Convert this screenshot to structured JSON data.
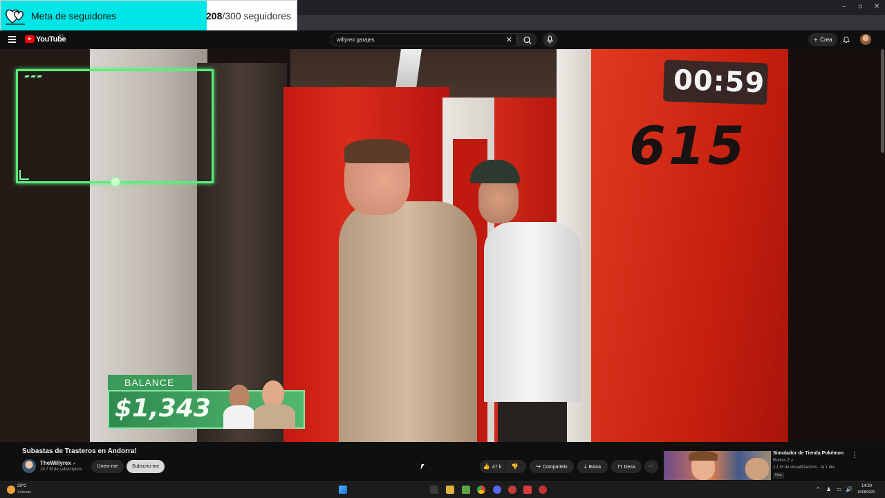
{
  "overlay": {
    "goal_label": "Meta de seguidores",
    "goal_current": "208",
    "goal_total": "/300 seguidores",
    "goal_progress_fraction": 0.693
  },
  "header": {
    "logo_text": "YouTube",
    "country_code": "ES",
    "search_value": "willyrex garajes",
    "create_label": "Crea"
  },
  "video": {
    "timer": "00:59",
    "unit_number": "615",
    "balance_label": "BALANCE",
    "balance_value": "$1,343"
  },
  "below_video": {
    "title": "Subastas de Trasteros en Andorra!",
    "channel_name": "TheWillyrex",
    "subscribers": "18,7 M de subscriptors",
    "join_label": "Uneix-me",
    "subscribe_label": "Subscriu-me",
    "like_count": "47 k",
    "share_label": "Comparteix",
    "download_label": "Baixa",
    "save_label": "Desa"
  },
  "recommendation": {
    "title": "Simulador de Tienda Pokémon",
    "channel": "Rubius Z",
    "meta": "2,1 M de visualitzacions · fa 1 dia",
    "badge": "Nou"
  },
  "taskbar": {
    "temperature": "29°C",
    "weather": "Soleado",
    "time": "14:30",
    "date": "10/08/2026"
  },
  "colors": {
    "goal_fill": "#00e5e5",
    "cam_frame": "#57f07a",
    "yt_red": "#ff0000",
    "balance_green": "#3c9a5a"
  }
}
